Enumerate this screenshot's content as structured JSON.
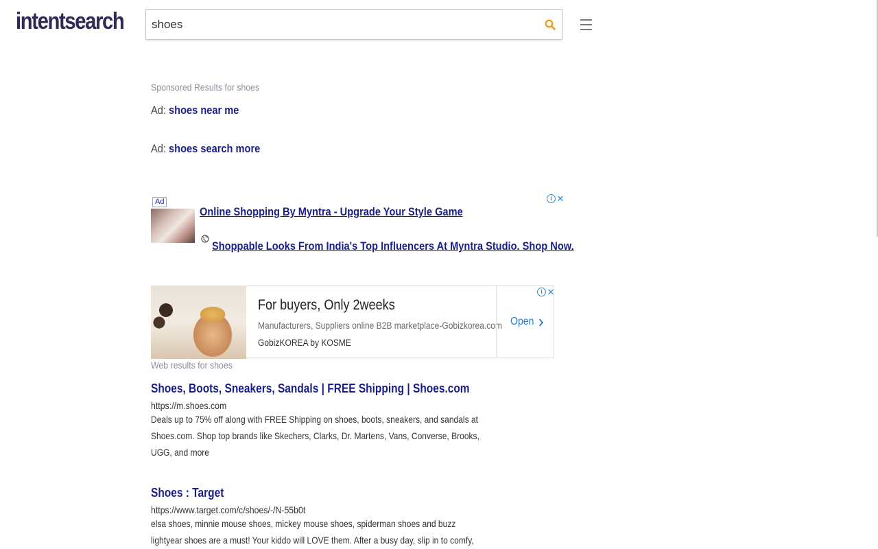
{
  "header": {
    "logo": "intentsearch",
    "search_value": "shoes"
  },
  "sponsored": {
    "label": "Sponsored Results for shoes",
    "ads": [
      {
        "prefix": "Ad:",
        "link": "shoes near me"
      },
      {
        "prefix": "Ad:",
        "link": "shoes search more"
      }
    ]
  },
  "ad_block_1": {
    "badge": "Ad",
    "title": "Online Shopping By Myntra - Upgrade Your Style Game",
    "description": "Shoppable Looks From India's Top Influencers At Myntra Studio. Shop Now.",
    "choices_i": "i",
    "choices_x": "✕"
  },
  "ad_block_2": {
    "title": "For buyers, Only 2weeks",
    "description": "Manufacturers, Suppliers online B2B marketplace-Gobizkorea.com",
    "brand": "GobizKOREA by KOSME",
    "cta": "Open",
    "choices_i": "i",
    "choices_x": "✕"
  },
  "web_results": {
    "label": "Web results for shoes",
    "items": [
      {
        "title": "Shoes, Boots, Sneakers, Sandals | FREE Shipping | Shoes.com",
        "url": "https://m.shoes.com",
        "description": "Deals up to 75% off along with FREE Shipping on shoes, boots, sneakers, and sandals at Shoes.com. Shop top brands like Skechers, Clarks, Dr. Martens, Vans, Converse, Brooks, UGG, and more"
      },
      {
        "title": "Shoes : Target",
        "url": "https://www.target.com/c/shoes/-/N-55b0t",
        "description": "elsa shoes, minnie mouse shoes, mickey mouse shoes, spiderman shoes and buzz lightyear shoes are a must! Your kiddo will LOVE them. After a busy day, slip in to comfy, cozy footwear"
      }
    ]
  },
  "colors": {
    "logo": "#2d2a55",
    "link": "#1a1f8a",
    "search_icon": "#f0a020",
    "muted": "#8a90a0",
    "adchoices": "#2a8fd0"
  }
}
